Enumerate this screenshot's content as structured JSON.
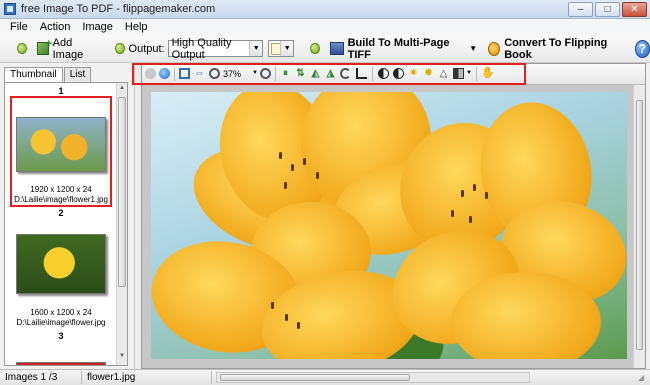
{
  "window": {
    "title": "free Image To PDF - flippagemaker.com"
  },
  "window_controls": {
    "minimize": "–",
    "maximize": "□",
    "close": "✕"
  },
  "menu": [
    "File",
    "Action",
    "Image",
    "Help"
  ],
  "toolbar": {
    "add_image": "Add Image",
    "output_label": "Output:",
    "output_value": "High Quality Output",
    "build_tiff": "Build To Multi-Page TIFF",
    "convert_flipping": "Convert To Flipping Book",
    "help": "?"
  },
  "left_panel": {
    "tabs": [
      "Thumbnail",
      "List"
    ],
    "thumbnails": [
      {
        "number": "1",
        "dims": "1920 x 1200 x 24",
        "path": "D:\\Lailie\\image\\flower1.jpg",
        "selected": true
      },
      {
        "number": "2",
        "dims": "1600 x 1200 x 24",
        "path": "D:\\Lailie\\image\\flower.jpg",
        "selected": false
      },
      {
        "number": "3"
      }
    ]
  },
  "viewer_toolbar": {
    "zoom": "37%"
  },
  "statusbar": {
    "images": "Images 1 /3",
    "filename": "flower1.jpg"
  }
}
